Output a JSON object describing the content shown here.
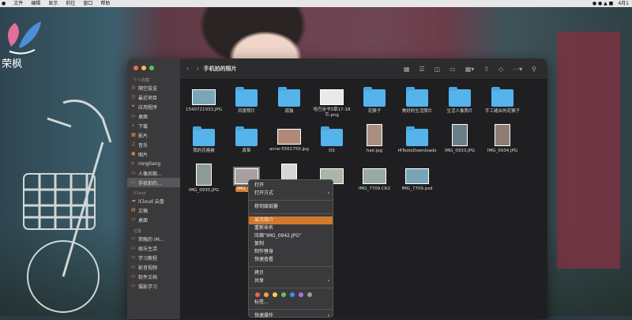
{
  "menubar": {
    "items": [
      "文件",
      "编辑",
      "显示",
      "前往",
      "窗口",
      "帮助"
    ],
    "right_text": "4月1"
  },
  "logo": {
    "text": "荣枫"
  },
  "window": {
    "title": "手机拍的照片",
    "sidebar": {
      "section_favorites": "个人收藏",
      "favorites": [
        {
          "label": "隔空投送",
          "icon": "airdrop-icon"
        },
        {
          "label": "最近项目",
          "icon": "clock-icon"
        },
        {
          "label": "应用程序",
          "icon": "apps-icon"
        },
        {
          "label": "桌面",
          "icon": "desktop-icon"
        },
        {
          "label": "下载",
          "icon": "download-icon"
        },
        {
          "label": "影片",
          "icon": "movie-icon"
        },
        {
          "label": "音乐",
          "icon": "music-icon"
        },
        {
          "label": "图片",
          "icon": "picture-icon"
        },
        {
          "label": "rongliang",
          "icon": "home-icon"
        },
        {
          "label": "人像后期...",
          "icon": "folder-icon"
        },
        {
          "label": "手机拍的...",
          "icon": "folder-icon"
        }
      ],
      "section_icloud": "iCloud",
      "icloud": [
        {
          "label": "iCloud 云盘",
          "icon": "cloud-icon"
        },
        {
          "label": "文稿",
          "icon": "document-icon"
        },
        {
          "label": "桌面",
          "icon": "desktop-icon"
        }
      ],
      "section_locations": "位置",
      "locations": [
        {
          "label": "荣融的 iM...",
          "icon": "computer-icon"
        },
        {
          "label": "娱乐生活",
          "icon": "folder-icon"
        },
        {
          "label": "学习教程",
          "icon": "folder-icon"
        },
        {
          "label": "影音视频",
          "icon": "folder-icon"
        },
        {
          "label": "软件文档",
          "icon": "folder-icon"
        },
        {
          "label": "摄影学习",
          "icon": "folder-icon"
        }
      ]
    },
    "toolbar": {
      "back": "‹",
      "forward": "›"
    },
    "files": [
      {
        "name": "1540721933.JPG",
        "kind": "image"
      },
      {
        "name": "风景照片",
        "kind": "folder"
      },
      {
        "name": "孤独",
        "kind": "folder"
      },
      {
        "name": "哈巴谷书3章17-18节.png",
        "kind": "image"
      },
      {
        "name": "花猴子",
        "kind": "folder"
      },
      {
        "name": "美好的生活照片",
        "kind": "folder"
      },
      {
        "name": "生活人像照片",
        "kind": "folder"
      },
      {
        "name": "手工缝合的花猴子",
        "kind": "folder"
      },
      {
        "name": "我的花格被",
        "kind": "folder"
      },
      {
        "name": "真挚",
        "kind": "folder"
      },
      {
        "name": "acne-5561750.jpg",
        "kind": "image"
      },
      {
        "name": "DS",
        "kind": "folder"
      },
      {
        "name": "hair.jpg",
        "kind": "image"
      },
      {
        "name": "I4ToolsDownloads",
        "kind": "folder"
      },
      {
        "name": "IMG_0933.JPG",
        "kind": "image"
      },
      {
        "name": "IMG_0934.JPG",
        "kind": "image"
      },
      {
        "name": "IMG_0935.JPG",
        "kind": "image"
      },
      {
        "name": "IMG_0942.JPG",
        "kind": "image",
        "selected": true,
        "shown_label": "IMG_094"
      },
      {
        "name": "",
        "kind": "image"
      },
      {
        "name": "",
        "kind": "image"
      },
      {
        "name": "IMG_7709.CR2",
        "kind": "image"
      },
      {
        "name": "IMG_7709.psd",
        "kind": "image"
      }
    ]
  },
  "context_menu": {
    "items": [
      {
        "label": "打开"
      },
      {
        "label": "打开方式",
        "submenu": true
      },
      {
        "sep": true
      },
      {
        "label": "移到废纸篓"
      },
      {
        "sep": true
      },
      {
        "label": "显示简介",
        "highlight": true
      },
      {
        "label": "重新命名"
      },
      {
        "label": "压缩“IMG_0942.JPG”"
      },
      {
        "label": "复制"
      },
      {
        "label": "制作替身"
      },
      {
        "label": "快速查看"
      },
      {
        "sep": true
      },
      {
        "label": "拷贝"
      },
      {
        "label": "共享",
        "submenu": true
      },
      {
        "sep": true
      },
      {
        "colors": true
      },
      {
        "label": "标签..."
      },
      {
        "sep": true
      },
      {
        "label": "快速操作",
        "submenu": true
      }
    ],
    "tag_colors": [
      "#ec5f5b",
      "#f3a33b",
      "#f6d44a",
      "#62c554",
      "#3d8ef7",
      "#b26ce6",
      "#9a9a9e"
    ]
  }
}
